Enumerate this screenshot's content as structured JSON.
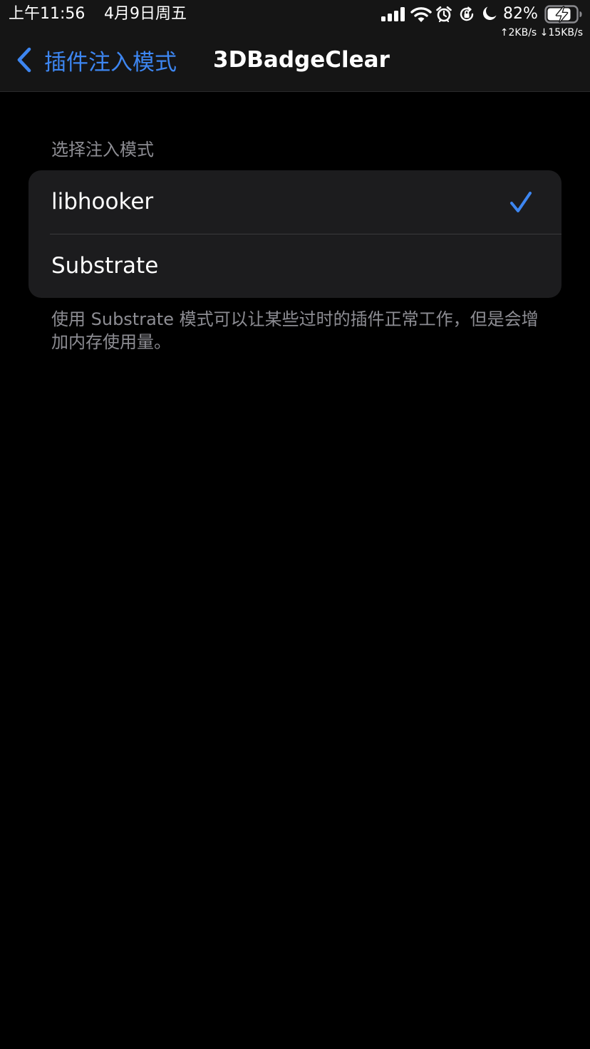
{
  "status_bar": {
    "time": "上午11:56",
    "date": "4月9日周五",
    "battery_percent": "82%",
    "network_speed": "↑2KB/s ↓15KB/s",
    "icons": [
      "cellular-signal-icon",
      "wifi-icon",
      "alarm-icon",
      "orientation-lock-icon",
      "do-not-disturb-icon",
      "battery-charging-icon"
    ]
  },
  "nav": {
    "back_label": "插件注入模式",
    "title": "3DBadgeClear"
  },
  "section": {
    "header": "选择注入模式",
    "options": [
      {
        "label": "libhooker",
        "selected": true
      },
      {
        "label": "Substrate",
        "selected": false
      }
    ],
    "footer": "使用 Substrate 模式可以让某些过时的插件正常工作，但是会增加内存使用量。"
  },
  "colors": {
    "accent": "#3d86f1",
    "background": "#000000",
    "bar_background": "#151515",
    "cell_background": "#1c1c1e",
    "secondary_text": "#8d8d93",
    "separator": "#3a3a3c"
  }
}
